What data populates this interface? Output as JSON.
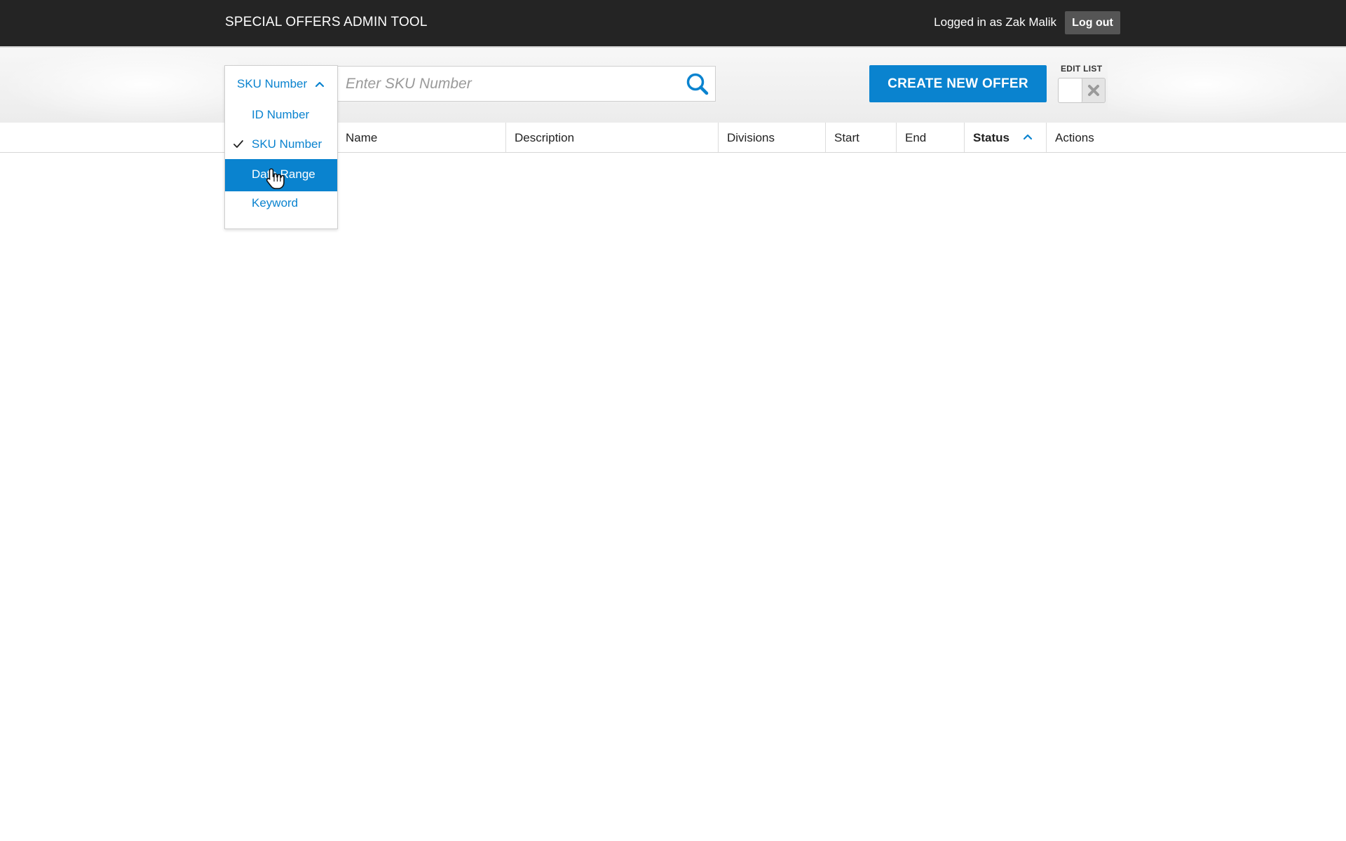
{
  "header": {
    "app_title": "SPECIAL OFFERS ADMIN TOOL",
    "login_text": "Logged in as Zak Malik",
    "logout_label": "Log out"
  },
  "search": {
    "type_selected": "SKU Number",
    "placeholder": "Enter SKU Number",
    "value": "",
    "options": [
      {
        "label": "ID Number",
        "checked": false,
        "highlighted": false
      },
      {
        "label": "SKU Number",
        "checked": true,
        "highlighted": false
      },
      {
        "label": "Date Range",
        "checked": false,
        "highlighted": true
      },
      {
        "label": "Keyword",
        "checked": false,
        "highlighted": false
      }
    ]
  },
  "toolbar": {
    "create_label": "CREATE NEW OFFER",
    "edit_list_label": "EDIT LIST",
    "edit_list_enabled": false
  },
  "table": {
    "columns": [
      "Name",
      "Description",
      "Divisions",
      "Start",
      "End",
      "Status",
      "Actions"
    ],
    "sorted_column": "Status",
    "sort_direction": "ascending",
    "rows": []
  },
  "colors": {
    "accent": "#0a83cf",
    "topbar": "#242424"
  },
  "icons": {
    "search": "search-icon",
    "dropdown": "chevron-up-icon",
    "check": "check-icon",
    "toggle_off": "x-icon",
    "sort": "sort-ascending-icon"
  }
}
